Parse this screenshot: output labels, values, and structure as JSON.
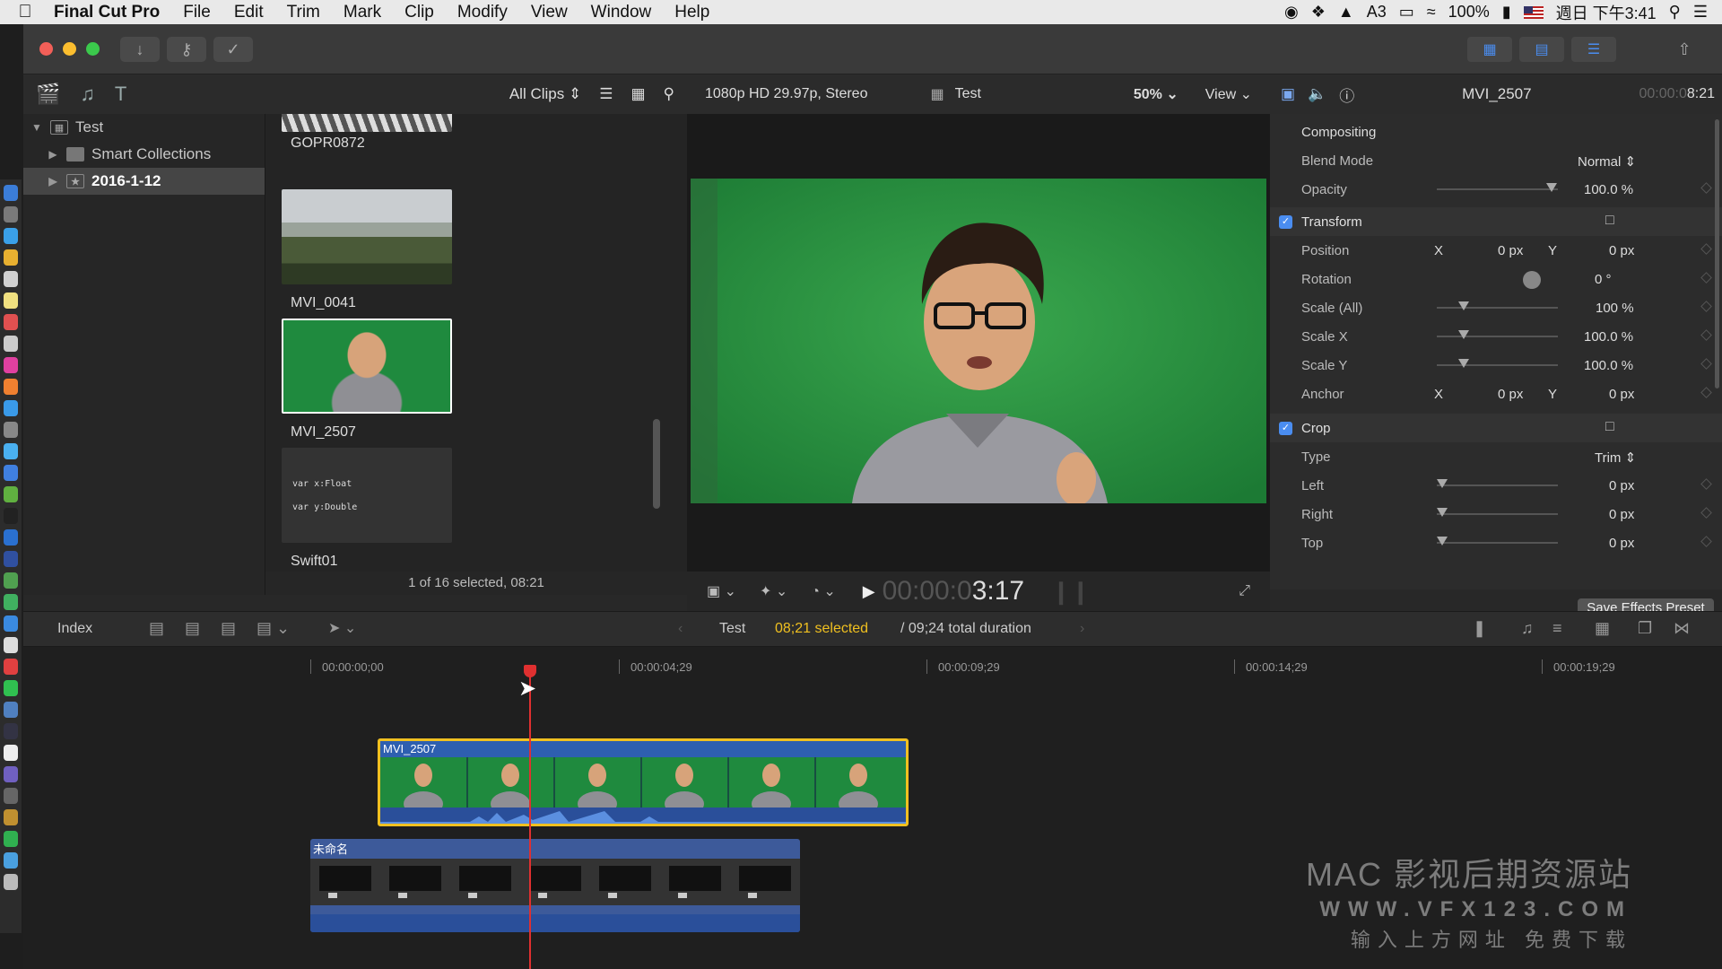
{
  "menubar": {
    "app_name": "Final Cut Pro",
    "items": [
      "File",
      "Edit",
      "Trim",
      "Mark",
      "Clip",
      "Modify",
      "View",
      "Window",
      "Help"
    ],
    "status": {
      "notifications_count": "3",
      "battery": "100%",
      "clock": "週日 下午3:41"
    }
  },
  "library": {
    "items": [
      {
        "label": "Test",
        "icon": "library-icon",
        "expanded": true
      },
      {
        "label": "Smart Collections",
        "icon": "folder-icon",
        "expanded": false
      },
      {
        "label": "2016-1-12",
        "icon": "event-star-icon",
        "expanded": false,
        "selected": true
      }
    ]
  },
  "browser": {
    "filter_label": "All Clips",
    "clips": [
      {
        "name": "GOPR0872",
        "kind": "partial"
      },
      {
        "name": "MVI_0041",
        "kind": "landscape"
      },
      {
        "name": "MVI_2507",
        "kind": "greenscreen",
        "selected": true
      },
      {
        "name": "Swift01",
        "kind": "code",
        "code_lines": [
          "var x:Float",
          "var y:Double"
        ]
      }
    ],
    "status": "1 of 16 selected, 08:21"
  },
  "viewer": {
    "format": "1080p HD 29.97p, Stereo",
    "project_name": "Test",
    "zoom": "50%",
    "view_label": "View",
    "timecode_dim": "00:00:0",
    "timecode_bright": "3:17"
  },
  "inspector": {
    "clip_name": "MVI_2507",
    "duration_dim": "00:00:0",
    "duration_bright": "8:21",
    "compositing_label": "Compositing",
    "blend_mode_label": "Blend Mode",
    "blend_mode_value": "Normal",
    "opacity_label": "Opacity",
    "opacity_value": "100.0",
    "opacity_unit": "%",
    "transform_label": "Transform",
    "position_label": "Position",
    "position_x": "0",
    "position_y": "0",
    "rotation_label": "Rotation",
    "rotation_value": "0",
    "rotation_unit": "°",
    "scale_all_label": "Scale (All)",
    "scale_all_value": "100",
    "scale_x_label": "Scale X",
    "scale_x_value": "100.0",
    "scale_y_label": "Scale Y",
    "scale_y_value": "100.0",
    "anchor_label": "Anchor",
    "anchor_x": "0",
    "anchor_y": "0",
    "crop_label": "Crop",
    "type_label": "Type",
    "type_value": "Trim",
    "left_label": "Left",
    "left_value": "0",
    "right_label": "Right",
    "right_value": "0",
    "top_label": "Top",
    "top_value": "0",
    "x_axis": "X",
    "y_axis": "Y",
    "px_unit": "px",
    "pct_unit": "%",
    "save_preset_label": "Save Effects Preset"
  },
  "timeline": {
    "index_label": "Index",
    "project_name": "Test",
    "selected_text": "08;21 selected",
    "total_text": "/ 09;24 total duration",
    "ruler": [
      "00:00:00;00",
      "00:00:04;29",
      "00:00:09;29",
      "00:00:14;29",
      "00:00:19;29"
    ],
    "primary_clip": "MVI_2507",
    "secondary_clip": "未命名"
  },
  "watermark": {
    "line1": "MAC 影视后期资源站",
    "line2": "WWW.VFX123.COM",
    "line3": "输入上方网址  免费下载"
  },
  "colors": {
    "accent_blue": "#4a8df0",
    "selection_yellow": "#f0c020",
    "playhead_red": "#e03030",
    "timeline_selected_text": "#f0c020"
  }
}
